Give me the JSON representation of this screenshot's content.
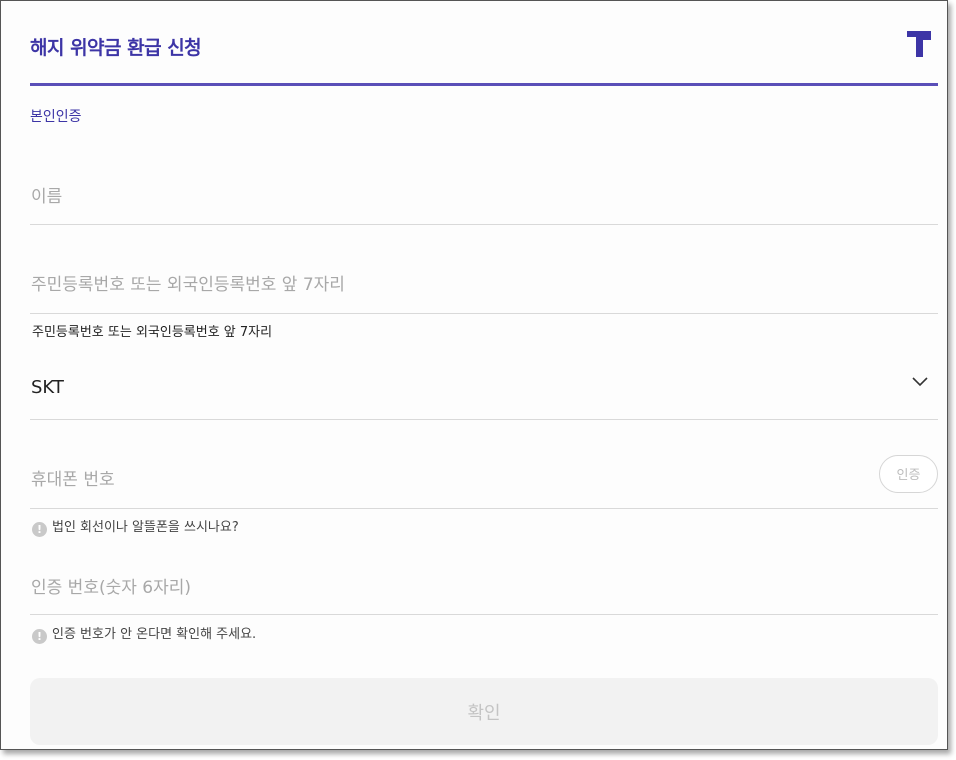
{
  "header": {
    "title": "해지 위약금 환급 신청",
    "logo_icon": "t-logo-icon",
    "brand_color": "#3d35a6"
  },
  "section": {
    "label": "본인인증"
  },
  "form": {
    "name": {
      "placeholder": "이름"
    },
    "resident_number": {
      "placeholder": "주민등록번호 또는 외국인등록번호 앞 7자리",
      "helper": "주민등록번호 또는 외국인등록번호 앞 7자리"
    },
    "carrier": {
      "selected": "SKT",
      "icon": "chevron-down-icon"
    },
    "phone": {
      "placeholder": "휴대폰 번호",
      "verify_label": "인증",
      "hint": "법인 회선이나 알뜰폰을 쓰시나요?"
    },
    "code": {
      "placeholder": "인증 번호(숫자 6자리)",
      "hint": "인증 번호가 안 온다면 확인해 주세요."
    }
  },
  "footer": {
    "confirm_label": "확인"
  }
}
